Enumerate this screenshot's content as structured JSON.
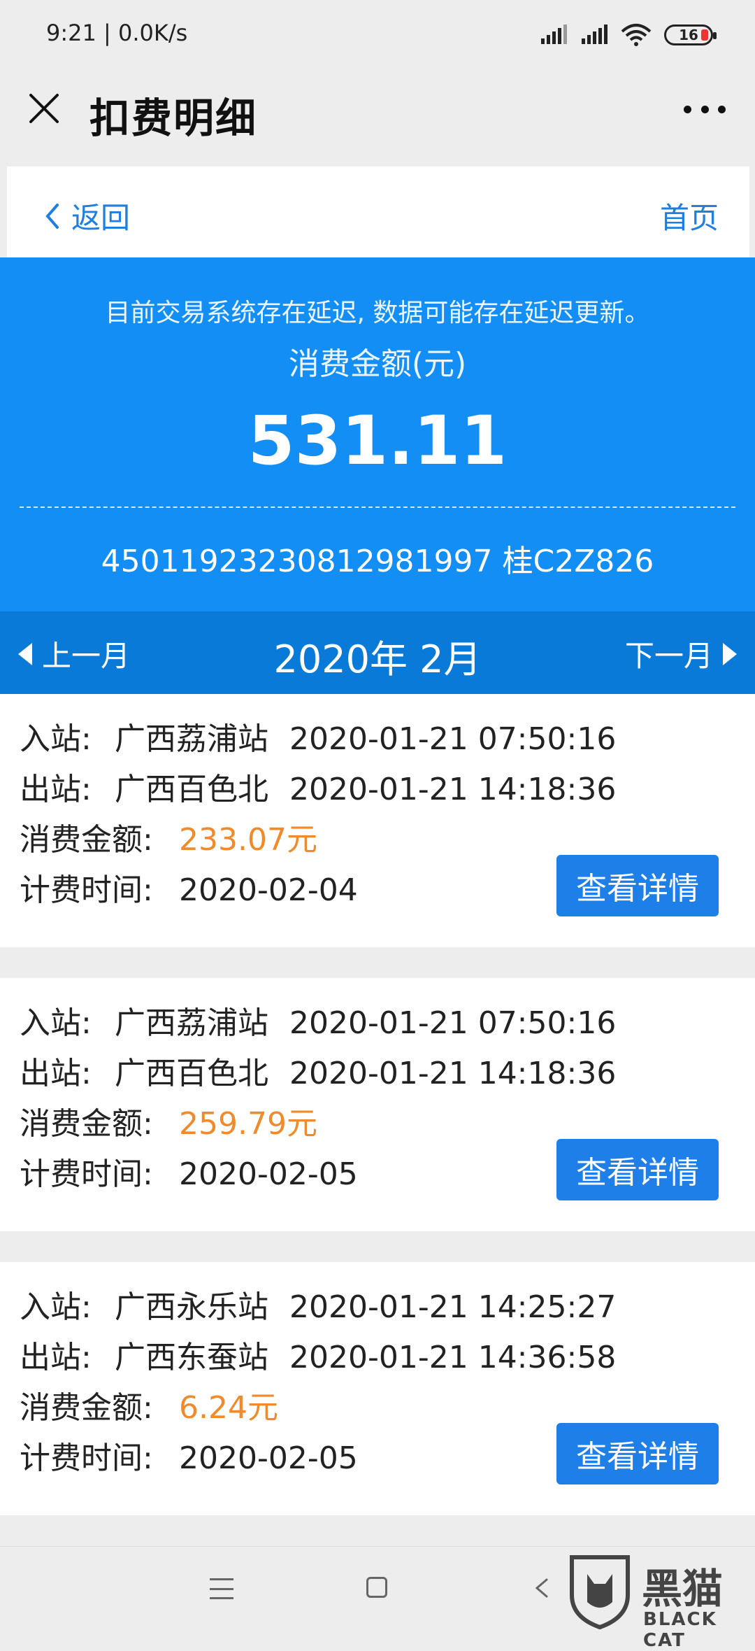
{
  "status_bar": {
    "time": "9:21 | 0.0K/s",
    "battery": "16"
  },
  "header": {
    "title": "扣费明细"
  },
  "nav": {
    "back_label": "返回",
    "home_label": "首页"
  },
  "summary": {
    "notice": "目前交易系统存在延迟, 数据可能存在延迟更新。",
    "amount_label": "消费金额(元)",
    "amount_value": "531.11",
    "card_info": "45011923230812981997 桂C2Z826"
  },
  "month_bar": {
    "prev_label": "上一月",
    "title": "2020年 2月",
    "next_label": "下一月"
  },
  "labels": {
    "entry": "入站:",
    "exit": "出站:",
    "amount": "消费金额:",
    "billing_time": "计费时间:",
    "detail_button": "查看详情"
  },
  "records": [
    {
      "entry_station": "广西荔浦站",
      "entry_time": "2020-01-21 07:50:16",
      "exit_station": "广西百色北",
      "exit_time": "2020-01-21 14:18:36",
      "amount": "233.07元",
      "billing_time": "2020-02-04"
    },
    {
      "entry_station": "广西荔浦站",
      "entry_time": "2020-01-21 07:50:16",
      "exit_station": "广西百色北",
      "exit_time": "2020-01-21 14:18:36",
      "amount": "259.79元",
      "billing_time": "2020-02-05"
    },
    {
      "entry_station": "广西永乐站",
      "entry_time": "2020-01-21 14:25:27",
      "exit_station": "广西东蚕站",
      "exit_time": "2020-01-21 14:36:58",
      "amount": "6.24元",
      "billing_time": "2020-02-05"
    }
  ],
  "watermark": {
    "text": "黑猫",
    "sub": "BLACK CAT"
  },
  "colors": {
    "accent_blue": "#128ef5",
    "month_blue": "#0a7ad8",
    "amount_orange": "#f08a2a",
    "button_blue": "#1e7fe8"
  }
}
